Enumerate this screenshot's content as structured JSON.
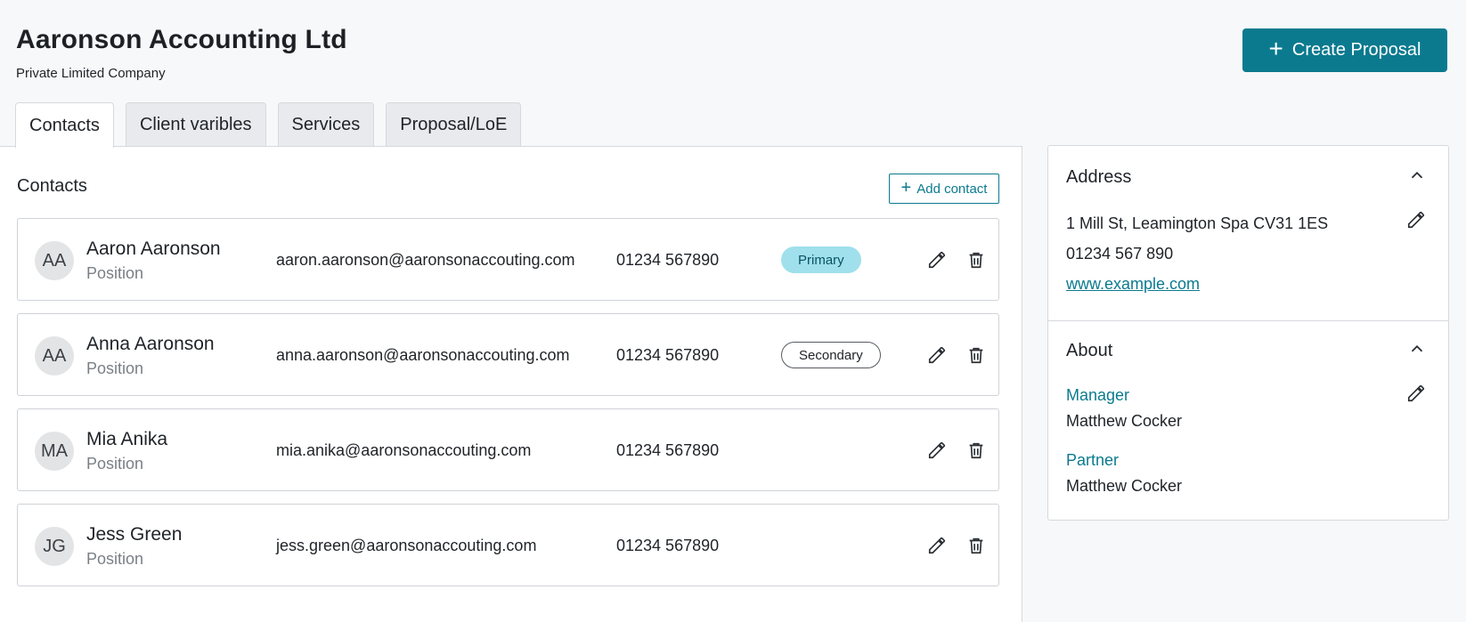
{
  "header": {
    "company_name": "Aaronson Accounting Ltd",
    "company_type": "Private Limited Company",
    "create_button_label": "Create Proposal"
  },
  "tabs": [
    {
      "label": "Contacts",
      "active": true
    },
    {
      "label": "Client varibles",
      "active": false
    },
    {
      "label": "Services",
      "active": false
    },
    {
      "label": "Proposal/LoE",
      "active": false
    }
  ],
  "contacts_section": {
    "title": "Contacts",
    "add_button_label": "Add contact",
    "contacts": [
      {
        "initials": "AA",
        "name": "Aaron Aaronson",
        "position": "Position",
        "email": "aaron.aaronson@aaronsonaccouting.com",
        "phone": "01234 567890",
        "badge": "Primary"
      },
      {
        "initials": "AA",
        "name": "Anna Aaronson",
        "position": "Position",
        "email": "anna.aaronson@aaronsonaccouting.com",
        "phone": "01234 567890",
        "badge": "Secondary"
      },
      {
        "initials": "MA",
        "name": "Mia Anika",
        "position": "Position",
        "email": "mia.anika@aaronsonaccouting.com",
        "phone": "01234 567890",
        "badge": ""
      },
      {
        "initials": "JG",
        "name": "Jess Green",
        "position": "Position",
        "email": "jess.green@aaronsonaccouting.com",
        "phone": "01234 567890",
        "badge": ""
      }
    ]
  },
  "address": {
    "title": "Address",
    "line1": "1 Mill St, Leamington Spa CV31 1ES",
    "phone": "01234 567 890",
    "website": "www.example.com"
  },
  "about": {
    "title": "About",
    "manager_label": "Manager",
    "manager_name": "Matthew Cocker",
    "partner_label": "Partner",
    "partner_name": "Matthew Cocker"
  },
  "colors": {
    "accent": "#0b7a8f",
    "primary_badge_bg": "#9fe0ec",
    "background": "#f7f8fa"
  },
  "icons": [
    "plus-icon",
    "edit-icon",
    "delete-icon",
    "chevron-up-icon"
  ]
}
